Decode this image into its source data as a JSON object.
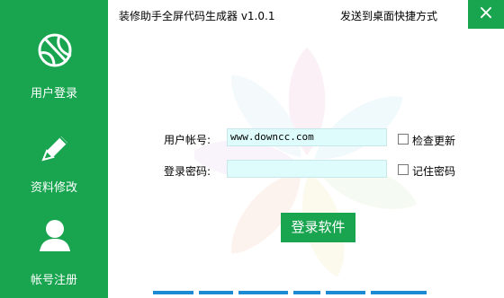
{
  "sidebar": {
    "items": [
      {
        "label": "用户登录",
        "icon": "basketball-icon"
      },
      {
        "label": "资料修改",
        "icon": "pencil-icon"
      },
      {
        "label": "帐号注册",
        "icon": "user-icon"
      }
    ]
  },
  "window": {
    "title": "装修助手全屏代码生成器 v1.0.1",
    "shortcut_label": "发送到桌面快捷方式",
    "close_icon": "×"
  },
  "form": {
    "username_label": "用户帐号:",
    "username_value": "www.downcc.com",
    "password_label": "登录密码:",
    "password_value": "",
    "check_update_label": "检查更新",
    "remember_password_label": "记住密码",
    "login_button": "登录软件"
  },
  "colors": {
    "accent": "#19a550",
    "input_bg": "#dffcfc"
  }
}
